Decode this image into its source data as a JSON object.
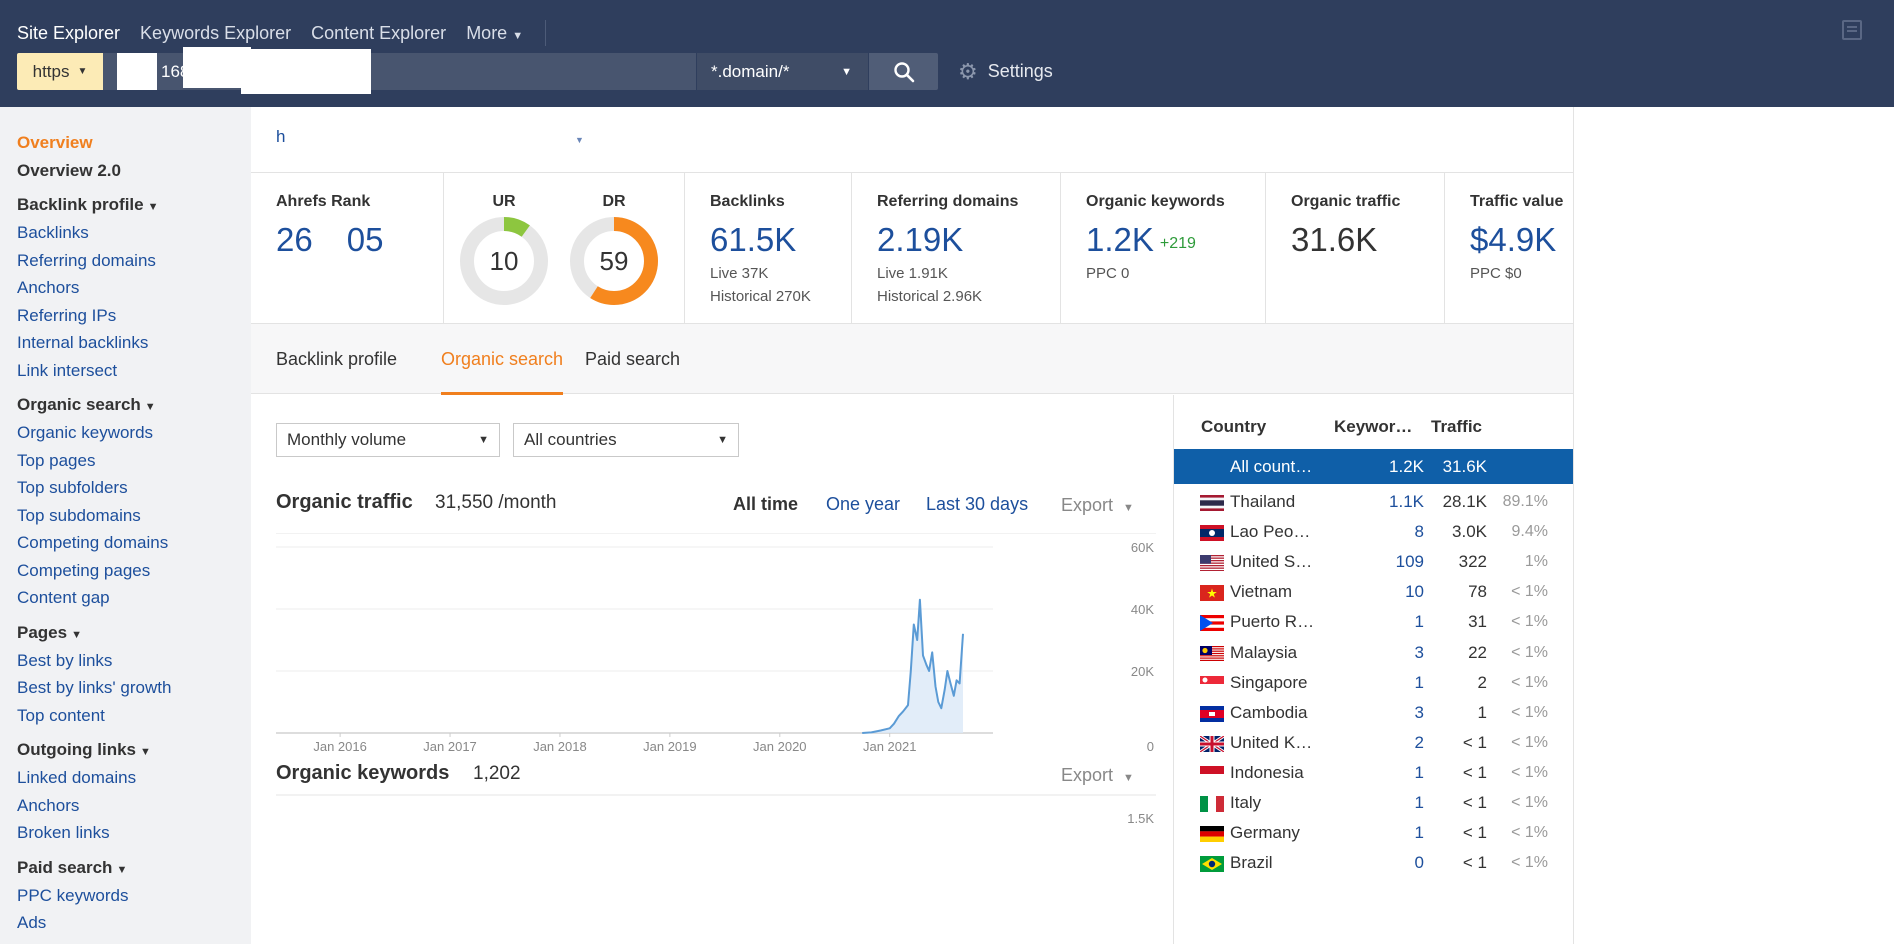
{
  "topnav": {
    "items": [
      "Site Explorer",
      "Keywords Explorer",
      "Content Explorer",
      "More"
    ]
  },
  "search": {
    "protocol": "https",
    "url_visible": "168",
    "mode": "*.domain/*",
    "settings_label": "Settings"
  },
  "sidebar": {
    "top": [
      "Overview",
      "Overview 2.0"
    ],
    "groups": [
      {
        "title": "Backlink profile",
        "items": [
          "Backlinks",
          "Referring domains",
          "Anchors",
          "Referring IPs",
          "Internal backlinks",
          "Link intersect"
        ]
      },
      {
        "title": "Organic search",
        "items": [
          "Organic keywords",
          "Top pages",
          "Top subfolders",
          "Top subdomains",
          "Competing domains",
          "Competing pages",
          "Content gap"
        ]
      },
      {
        "title": "Pages",
        "items": [
          "Best by links",
          "Best by links' growth",
          "Top content"
        ]
      },
      {
        "title": "Outgoing links",
        "items": [
          "Linked domains",
          "Anchors",
          "Broken links"
        ]
      },
      {
        "title": "Paid search",
        "items": [
          "PPC keywords",
          "Ads"
        ]
      }
    ]
  },
  "target": {
    "text": "h"
  },
  "metrics": {
    "ahrefs_rank": {
      "label": "Ahrefs Rank",
      "value_a": "26",
      "value_b": "05"
    },
    "ur": {
      "label": "UR",
      "value": "10",
      "score": 10
    },
    "dr": {
      "label": "DR",
      "value": "59",
      "score": 59
    },
    "backlinks": {
      "label": "Backlinks",
      "value": "61.5K",
      "live": "Live 37K",
      "historical": "Historical 270K"
    },
    "ref_domains": {
      "label": "Referring domains",
      "value": "2.19K",
      "live": "Live 1.91K",
      "historical": "Historical 2.96K"
    },
    "organic_keywords": {
      "label": "Organic keywords",
      "value": "1.2K",
      "delta": "+219",
      "ppc": "PPC 0"
    },
    "organic_traffic": {
      "label": "Organic traffic",
      "value": "31.6K"
    },
    "traffic_value": {
      "label": "Traffic value",
      "value": "$4.9K",
      "ppc": "PPC $0"
    }
  },
  "tabs": [
    "Backlink profile",
    "Organic search",
    "Paid search"
  ],
  "filters": {
    "volume": "Monthly volume",
    "countries": "All countries"
  },
  "traffic_section": {
    "title": "Organic traffic",
    "value": "31,550 /month",
    "ranges": [
      "All time",
      "One year",
      "Last 30 days"
    ],
    "export": "Export"
  },
  "keywords_section": {
    "title": "Organic keywords",
    "value": "1,202",
    "export": "Export",
    "y_top_label": "1.5K"
  },
  "colors": {
    "accent": "#f07f1e",
    "link": "#1d4f9c",
    "nav": "#2f3e5d",
    "line": "#5b9bd5",
    "selected": "#0f5fa8"
  },
  "country_table": {
    "headers": [
      "Country",
      "Keywor…",
      "Traffic"
    ],
    "rows": [
      {
        "flag": "",
        "name": "All count…",
        "kw": "1.2K",
        "traffic": "31.6K",
        "pct": "",
        "selected": true
      },
      {
        "flag": "th",
        "name": "Thailand",
        "kw": "1.1K",
        "traffic": "28.1K",
        "pct": "89.1%"
      },
      {
        "flag": "la",
        "name": "Lao Peo…",
        "kw": "8",
        "traffic": "3.0K",
        "pct": "9.4%"
      },
      {
        "flag": "us",
        "name": "United S…",
        "kw": "109",
        "traffic": "322",
        "pct": "1%"
      },
      {
        "flag": "vn",
        "name": "Vietnam",
        "kw": "10",
        "traffic": "78",
        "pct": "< 1%"
      },
      {
        "flag": "pr",
        "name": "Puerto R…",
        "kw": "1",
        "traffic": "31",
        "pct": "< 1%"
      },
      {
        "flag": "my",
        "name": "Malaysia",
        "kw": "3",
        "traffic": "22",
        "pct": "< 1%"
      },
      {
        "flag": "sg",
        "name": "Singapore",
        "kw": "1",
        "traffic": "2",
        "pct": "< 1%"
      },
      {
        "flag": "kh",
        "name": "Cambodia",
        "kw": "3",
        "traffic": "1",
        "pct": "< 1%"
      },
      {
        "flag": "gb",
        "name": "United K…",
        "kw": "2",
        "traffic": "< 1",
        "pct": "< 1%"
      },
      {
        "flag": "id",
        "name": "Indonesia",
        "kw": "1",
        "traffic": "< 1",
        "pct": "< 1%"
      },
      {
        "flag": "it",
        "name": "Italy",
        "kw": "1",
        "traffic": "< 1",
        "pct": "< 1%"
      },
      {
        "flag": "de",
        "name": "Germany",
        "kw": "1",
        "traffic": "< 1",
        "pct": "< 1%"
      },
      {
        "flag": "br",
        "name": "Brazil",
        "kw": "0",
        "traffic": "< 1",
        "pct": "< 1%"
      }
    ]
  },
  "chart_data": {
    "type": "area",
    "title": "Organic traffic",
    "x_ticks": [
      "Jan 2016",
      "Jan 2017",
      "Jan 2018",
      "Jan 2019",
      "Jan 2020",
      "Jan 2021"
    ],
    "y_ticks": [
      "60K",
      "40K",
      "20K",
      "0"
    ],
    "ylim": [
      0,
      60000
    ],
    "xlim": [
      "2015-06",
      "2021-09"
    ],
    "grid": true,
    "series": [
      {
        "x": [
          "2020-10",
          "2020-11",
          "2020-12",
          "2021-01",
          "2021-01-15",
          "2021-02",
          "2021-02-15",
          "2021-03",
          "2021-03-10",
          "2021-03-20",
          "2021-04",
          "2021-04-10",
          "2021-04-20",
          "2021-05",
          "2021-05-10",
          "2021-05-20",
          "2021-06",
          "2021-06-10",
          "2021-06-20",
          "2021-07",
          "2021-07-10",
          "2021-07-20",
          "2021-08",
          "2021-08-10",
          "2021-08-20",
          "2021-09"
        ],
        "y": [
          0,
          200,
          800,
          1500,
          3000,
          5500,
          7000,
          9000,
          20000,
          35000,
          30000,
          43000,
          25000,
          22000,
          20000,
          26000,
          15000,
          10000,
          8000,
          14000,
          20000,
          16000,
          12000,
          17000,
          16000,
          32000
        ]
      }
    ]
  }
}
